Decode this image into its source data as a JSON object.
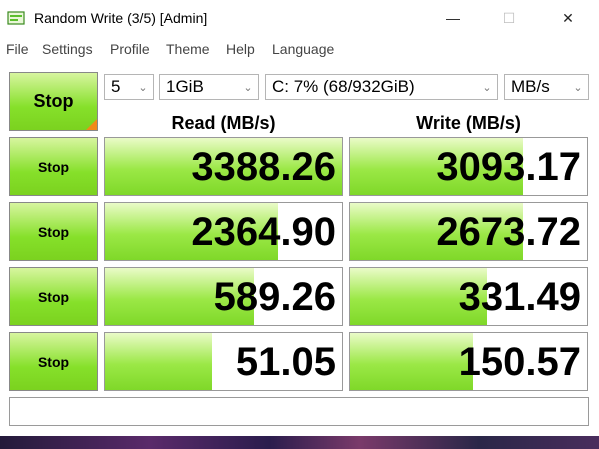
{
  "window": {
    "title": "Random Write (3/5) [Admin]",
    "minimize_glyph": "—",
    "maximize_glyph": "☐",
    "close_glyph": "✕"
  },
  "menu": [
    "File",
    "Settings",
    "Profile",
    "Theme",
    "Help",
    "Language"
  ],
  "controls": {
    "all_button": "Stop",
    "count": "5",
    "size": "1GiB",
    "drive": "C: 7% (68/932GiB)",
    "unit": "MB/s"
  },
  "headers": {
    "read": "Read (MB/s)",
    "write": "Write (MB/s)"
  },
  "rows": [
    {
      "button": "Stop",
      "read": "3388.26",
      "write": "3093.17",
      "read_fill": 1.0,
      "write_fill": 0.73
    },
    {
      "button": "Stop",
      "read": "2364.90",
      "write": "2673.72",
      "read_fill": 0.73,
      "write_fill": 0.73
    },
    {
      "button": "Stop",
      "read": "589.26",
      "write": "331.49",
      "read_fill": 0.63,
      "write_fill": 0.58
    },
    {
      "button": "Stop",
      "read": "51.05",
      "write": "150.57",
      "read_fill": 0.45,
      "write_fill": 0.52
    }
  ],
  "status_text": "",
  "colors": {
    "accent_green": "#86e02a",
    "corner_orange": "#f28a1a"
  }
}
